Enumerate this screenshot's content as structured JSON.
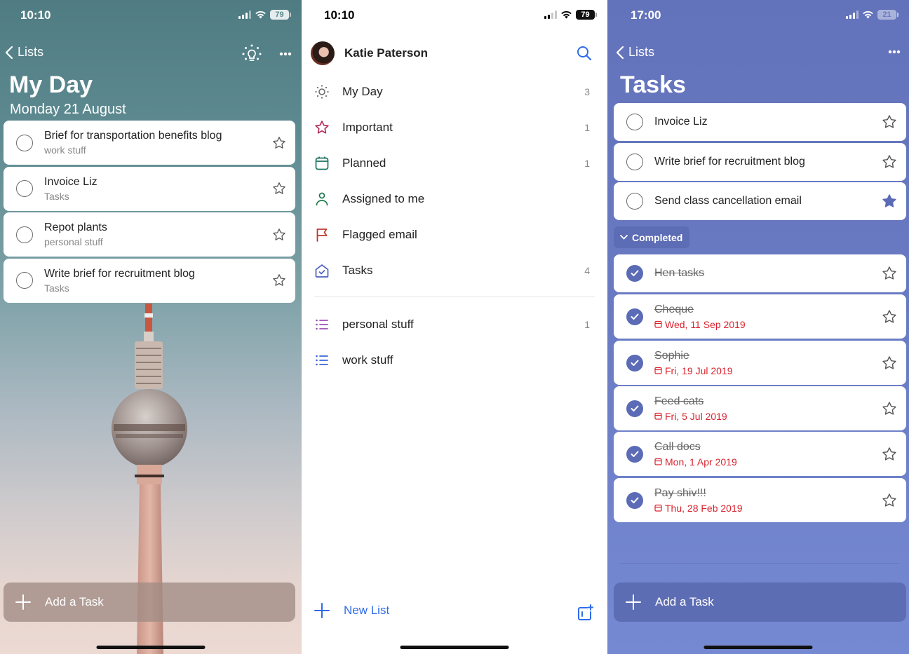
{
  "screens": [
    {
      "name": "my-day",
      "status": {
        "time": "10:10",
        "battery": "79"
      },
      "nav": {
        "back_label": "Lists",
        "suggestions_icon": "lightbulb-icon",
        "more_icon": "more-icon"
      },
      "title": "My Day",
      "date": "Monday 21 August",
      "tasks": [
        {
          "title": "Brief for transportation benefits blog",
          "list": "work stuff",
          "important": false
        },
        {
          "title": "Invoice Liz",
          "list": "Tasks",
          "important": false
        },
        {
          "title": "Repot plants",
          "list": "personal stuff",
          "important": false
        },
        {
          "title": "Write brief for recruitment blog",
          "list": "Tasks",
          "important": false
        }
      ],
      "add_task_label": "Add a Task"
    },
    {
      "name": "lists",
      "status": {
        "time": "10:10",
        "battery": "79"
      },
      "user_name": "Katie Paterson",
      "smart_lists": [
        {
          "label": "My Day",
          "count": "3",
          "icon": "sun-icon",
          "color": "#6b6b6b"
        },
        {
          "label": "Important",
          "count": "1",
          "icon": "star-icon",
          "color": "#b5315a"
        },
        {
          "label": "Planned",
          "count": "1",
          "icon": "calendar-icon",
          "color": "#1d7361"
        },
        {
          "label": "Assigned to me",
          "count": "",
          "icon": "person-icon",
          "color": "#1d7a4f"
        },
        {
          "label": "Flagged email",
          "count": "",
          "icon": "flag-icon",
          "color": "#c0392b"
        },
        {
          "label": "Tasks",
          "count": "4",
          "icon": "home-icon",
          "color": "#4b5fc4"
        }
      ],
      "custom_lists": [
        {
          "label": "personal stuff",
          "count": "1",
          "icon": "list-icon",
          "color": "#9b4fb2"
        },
        {
          "label": "work stuff",
          "count": "",
          "icon": "list-icon",
          "color": "#3a66d6"
        }
      ],
      "new_list_label": "New List",
      "accent_color": "#2f6ce8"
    },
    {
      "name": "tasks",
      "status": {
        "time": "17:00",
        "battery": "21"
      },
      "nav": {
        "back_label": "Lists",
        "more_icon": "more-icon"
      },
      "title": "Tasks",
      "tasks": [
        {
          "title": "Invoice Liz",
          "important": false
        },
        {
          "title": "Write brief for recruitment blog",
          "important": false
        },
        {
          "title": "Send class cancellation email",
          "important": true
        }
      ],
      "completed_label": "Completed",
      "completed": [
        {
          "title": "Hen tasks",
          "due": ""
        },
        {
          "title": "Cheque",
          "due": "Wed, 11 Sep 2019"
        },
        {
          "title": "Sophie",
          "due": "Fri, 19 Jul 2019"
        },
        {
          "title": "Feed cats",
          "due": "Fri, 5 Jul 2019"
        },
        {
          "title": "Call docs",
          "due": "Mon, 1 Apr 2019"
        },
        {
          "title": "Pay shiv!!!",
          "due": "Thu, 28 Feb 2019"
        }
      ],
      "add_task_label": "Add a Task",
      "accent_color": "#5b6bb6",
      "overdue_color": "#d9232e"
    }
  ]
}
